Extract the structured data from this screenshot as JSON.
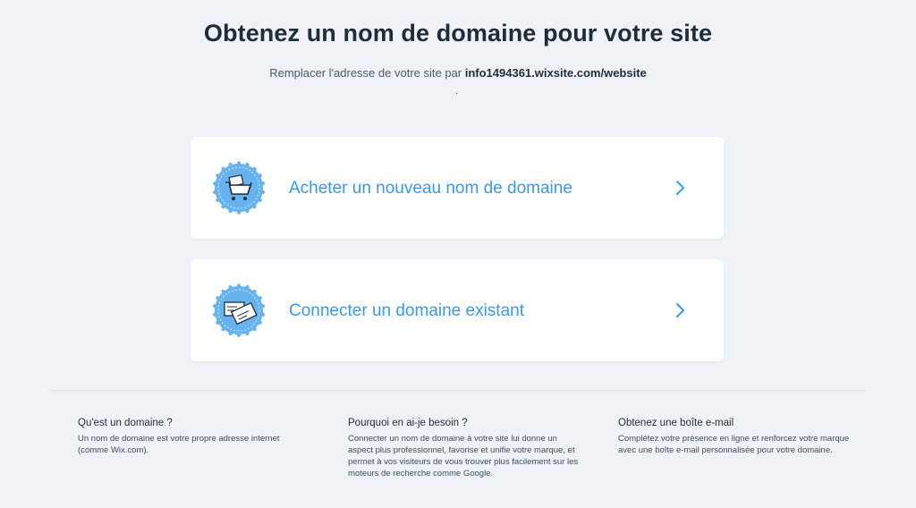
{
  "header": {
    "title": "Obtenez un nom de domaine pour votre site",
    "subtitle_prefix": "Remplacer l'adresse de votre site par ",
    "subtitle_url": "info1494361.wixsite.com/website",
    "trailing_dot": "."
  },
  "options": [
    {
      "label": "Acheter un nouveau nom de domaine",
      "icon": "shopping-cart-icon"
    },
    {
      "label": "Connecter un domaine existant",
      "icon": "domain-cards-icon"
    }
  ],
  "info": [
    {
      "title": "Qu'est un domaine ?",
      "text": "Un nom de domaine est votre propre adresse internet (comme Wix.com)."
    },
    {
      "title": "Pourquoi en ai-je besoin ?",
      "text": "Connecter un nom de domaine à votre site lui donne un aspect plus professionnel, favorise et unifie votre marque, et permet à vos visiteurs de vous trouver plus facilement sur les moteurs de recherche comme Google."
    },
    {
      "title": "Obtenez une boîte e-mail",
      "text": "Complétez votre présence en ligne et renforcez votre marque avec une boîte e-mail personnalisée pour votre domaine."
    }
  ],
  "colors": {
    "background": "#eff2f6",
    "accent": "#3899ec",
    "badge": "#67b3ef",
    "heading": "#1f2d3a"
  }
}
